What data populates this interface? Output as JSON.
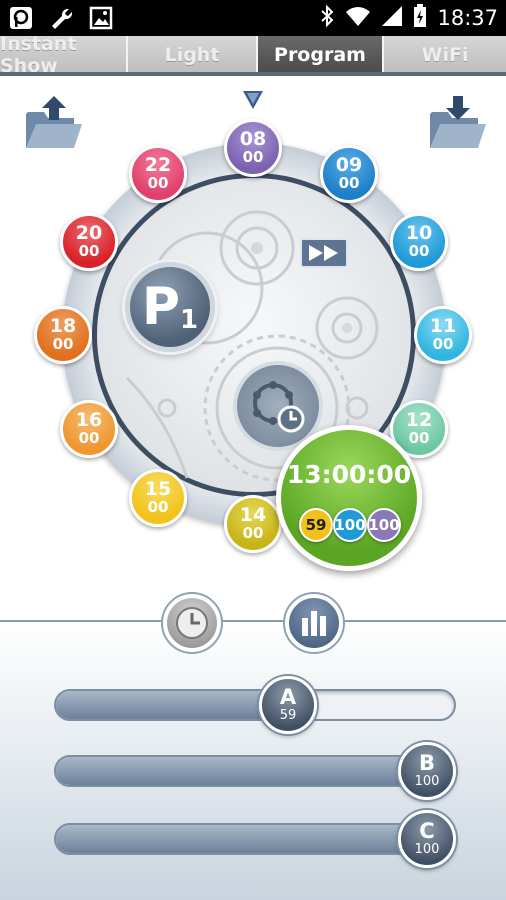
{
  "status_bar": {
    "time": "18:37",
    "left_icons": [
      "app-notification-icon",
      "wrench-icon",
      "image-icon"
    ],
    "right_icons": [
      "bluetooth-icon",
      "wifi-icon",
      "signal-icon",
      "battery-icon"
    ]
  },
  "tabs": [
    {
      "label": "Instant Show",
      "active": false
    },
    {
      "label": "Light",
      "active": false
    },
    {
      "label": "Program",
      "active": true
    },
    {
      "label": "WiFi",
      "active": false
    }
  ],
  "toolbar": {
    "left_icon": "folder-upload-icon",
    "right_icon": "folder-download-icon"
  },
  "program": {
    "badge_letter": "P",
    "badge_number": "1",
    "timeline": [
      {
        "hour": "08",
        "minute": "00",
        "color": "#7b62b0"
      },
      {
        "hour": "09",
        "minute": "00",
        "color": "#1d7fc8"
      },
      {
        "hour": "10",
        "minute": "00",
        "color": "#1e9ad6"
      },
      {
        "hour": "11",
        "minute": "00",
        "color": "#2fb5e0"
      },
      {
        "hour": "12",
        "minute": "00",
        "color": "#6cc7a3"
      },
      {
        "hour": "14",
        "minute": "00",
        "color": "#c8b416"
      },
      {
        "hour": "15",
        "minute": "00",
        "color": "#f2c21a"
      },
      {
        "hour": "16",
        "minute": "00",
        "color": "#f0962e"
      },
      {
        "hour": "18",
        "minute": "00",
        "color": "#e0701f"
      },
      {
        "hour": "20",
        "minute": "00",
        "color": "#d8212a"
      },
      {
        "hour": "22",
        "minute": "00",
        "color": "#e0406a"
      }
    ],
    "current": {
      "time": "13:00:00",
      "levels": [
        {
          "value": "59",
          "color": "#f2c21a",
          "text_color": "#222222"
        },
        {
          "value": "100",
          "color": "#1e9ad6",
          "text_color": "#ffffff"
        },
        {
          "value": "100",
          "color": "#8a78b6",
          "text_color": "#ffffff"
        }
      ]
    },
    "play_icon": "fast-forward-icon",
    "gear_icon": "program-gear-icon"
  },
  "modes": [
    {
      "name": "clock-mode-icon",
      "selected": true
    },
    {
      "name": "bar-chart-mode-icon",
      "selected": false
    }
  ],
  "channels": [
    {
      "label": "A",
      "value": "59",
      "level": 0.59
    },
    {
      "label": "B",
      "value": "100",
      "level": 1.0
    },
    {
      "label": "C",
      "value": "100",
      "level": 1.0
    }
  ]
}
